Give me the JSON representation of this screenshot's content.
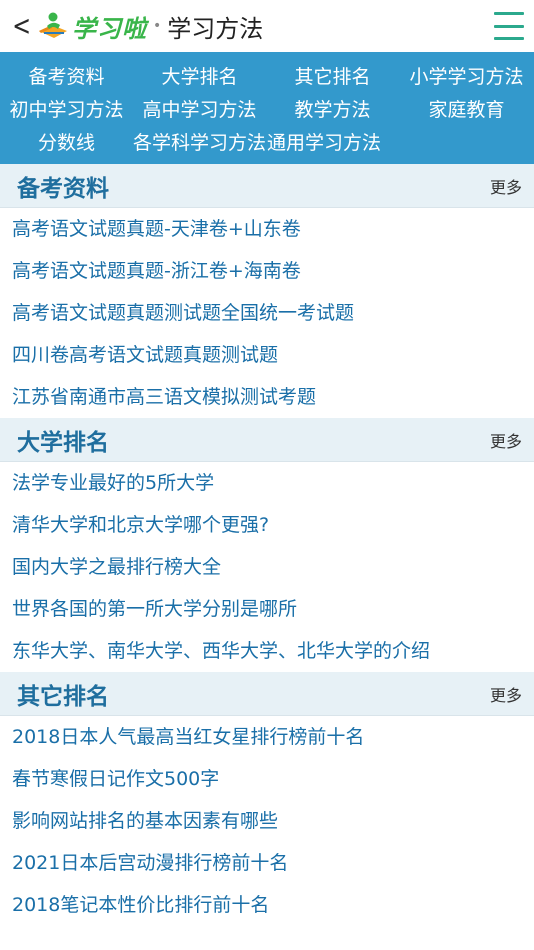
{
  "header": {
    "back_label": "<",
    "logo_text": "学习啦",
    "separator": "•",
    "title": "学习方法",
    "menu_icon": "hamburger-icon",
    "accent_color": "#2ba98d"
  },
  "nav": {
    "rows": [
      [
        "备考资料",
        "大学排名",
        "其它排名",
        "小学学习方法"
      ],
      [
        "初中学习方法",
        "高中学习方法",
        "教学方法",
        "家庭教育"
      ],
      [
        "分数线",
        "各学科学习方法",
        "通用学习方法"
      ]
    ],
    "background_color": "#3399cc"
  },
  "sections": [
    {
      "title": "备考资料",
      "more": "更多",
      "items": [
        "高考语文试题真题-天津卷+山东卷",
        "高考语文试题真题-浙江卷+海南卷",
        "高考语文试题真题测试题全国统一考试题",
        "四川卷高考语文试题真题测试题",
        "江苏省南通市高三语文模拟测试考题"
      ]
    },
    {
      "title": "大学排名",
      "more": "更多",
      "items": [
        "法学专业最好的5所大学",
        "清华大学和北京大学哪个更强?",
        "国内大学之最排行榜大全",
        "世界各国的第一所大学分别是哪所",
        "东华大学、南华大学、西华大学、北华大学的介绍"
      ]
    },
    {
      "title": "其它排名",
      "more": "更多",
      "items": [
        "2018日本人气最高当红女星排行榜前十名",
        "春节寒假日记作文500字",
        "影响网站排名的基本因素有哪些",
        "2021日本后宫动漫排行榜前十名",
        "2018笔记本性价比排行前十名"
      ]
    }
  ]
}
